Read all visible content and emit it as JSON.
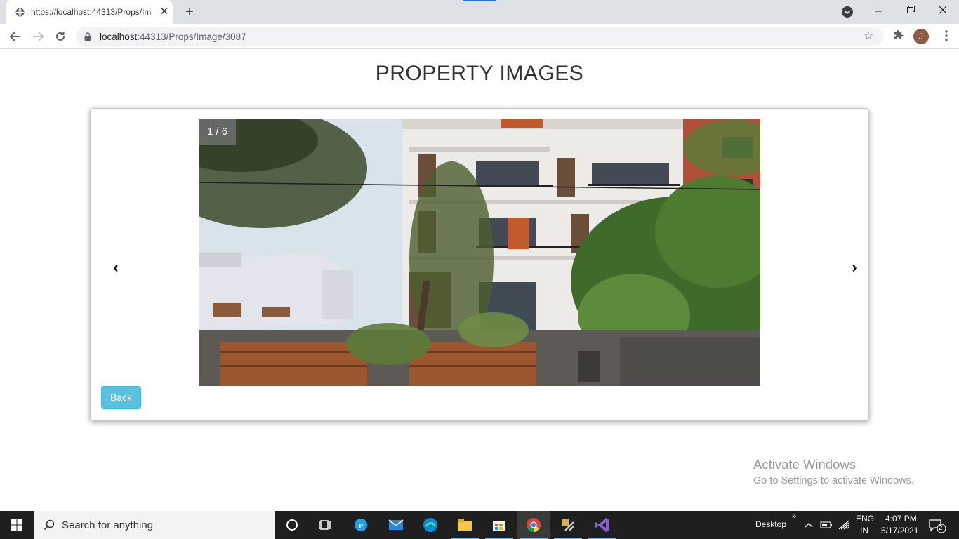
{
  "browser": {
    "tab_title": "https://localhost:44313/Props/Im",
    "tab_close": "✕",
    "new_tab": "+",
    "url_host": "localhost",
    "url_path": ":44313/Props/Image/3087",
    "profile_initial": "J"
  },
  "page": {
    "title": "PROPERTY IMAGES",
    "carousel": {
      "counter": "1 / 6",
      "prev": "‹",
      "next": "›"
    },
    "back_label": "Back"
  },
  "watermark": {
    "line1": "Activate Windows",
    "line2": "Go to Settings to activate Windows."
  },
  "taskbar": {
    "search_placeholder": "Search for anything",
    "desktop_label": "Desktop",
    "chevron": "»",
    "lang_line1": "ENG",
    "lang_line2": "IN",
    "time": "4:07 PM",
    "date": "5/17/2021",
    "notification_count": "2"
  },
  "colors": {
    "back_button": "#5bc0de",
    "chrome_tabstrip": "#dee1e6",
    "taskbar": "#1f1f1f"
  }
}
